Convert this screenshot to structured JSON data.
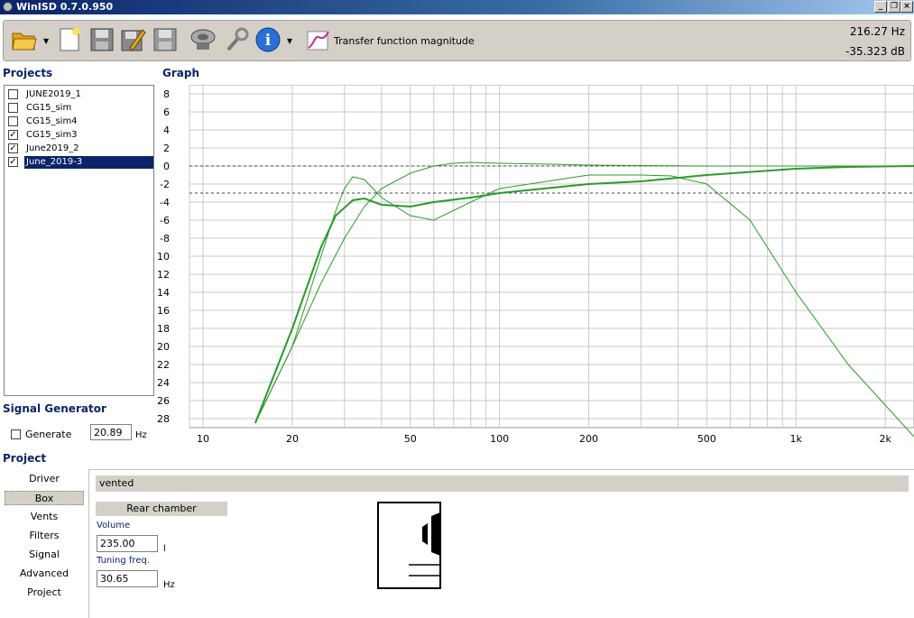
{
  "window": {
    "title": "WinISD 0.7.0.950"
  },
  "toolbar": {
    "graph_type_label": "Transfer function magnitude",
    "readout_hz": "216.27 Hz",
    "readout_db": "-35.323 dB"
  },
  "projects": {
    "heading": "Projects",
    "items": [
      {
        "label": "JUNE2019_1",
        "checked": false,
        "selected": false
      },
      {
        "label": "CG15_sim",
        "checked": false,
        "selected": false
      },
      {
        "label": "CG15_sim4",
        "checked": false,
        "selected": false
      },
      {
        "label": "CG15_sim3",
        "checked": true,
        "selected": false
      },
      {
        "label": "June2019_2",
        "checked": true,
        "selected": false
      },
      {
        "label": "June_2019-3",
        "checked": true,
        "selected": true
      }
    ]
  },
  "graph": {
    "heading": "Graph",
    "y_ticks": [
      "8",
      "6",
      "4",
      "2",
      "0",
      "-2",
      "-4",
      "-6",
      "-8",
      "-10",
      "-12",
      "-14",
      "-16",
      "-18",
      "-20",
      "-22",
      "-24",
      "-26",
      "-28"
    ],
    "x_ticks": [
      "10",
      "20",
      "50",
      "100",
      "200",
      "500",
      "1k",
      "2k"
    ]
  },
  "signal_generator": {
    "heading": "Signal Generator",
    "generate_label": "Generate",
    "checked": false,
    "frequency": "20.89",
    "unit": "Hz"
  },
  "project": {
    "heading": "Project",
    "nav": [
      "Driver",
      "Box",
      "Vents",
      "Filters",
      "Signal",
      "Advanced",
      "Project"
    ],
    "selected_nav": "Box",
    "box_type": "vented",
    "rear_chamber_label": "Rear chamber",
    "volume_label": "Volume",
    "volume_value": "235.00",
    "volume_unit": "l",
    "tuning_label": "Tuning freq.",
    "tuning_value": "30.65",
    "tuning_unit": "Hz"
  },
  "colors": {
    "curve": "#2a9a2a",
    "grid": "#c8c8c8",
    "heading": "#0a246a"
  },
  "chart_data": {
    "type": "line",
    "xlabel": "",
    "ylabel": "",
    "x_scale": "log",
    "xlim": [
      9,
      2500
    ],
    "ylim": [
      -29,
      9
    ],
    "reference_lines": [
      0,
      -3
    ],
    "series": [
      {
        "x": [
          15,
          20,
          25,
          28,
          30,
          32,
          35,
          40,
          50,
          60,
          80,
          100,
          200,
          300,
          380,
          500,
          700,
          1000,
          1500,
          2500
        ],
        "y": [
          -28.5,
          -20,
          -10,
          -5,
          -2.5,
          -1.2,
          -1.5,
          -3.5,
          -5.5,
          -6,
          -4,
          -2.5,
          -1,
          -1,
          -1.1,
          -2,
          -6,
          -14,
          -22,
          -30
        ]
      },
      {
        "x": [
          15,
          20,
          25,
          28,
          32,
          35,
          40,
          50,
          60,
          80,
          100,
          200,
          300,
          500,
          1000,
          1500,
          2500
        ],
        "y": [
          -28.5,
          -18,
          -9,
          -5.5,
          -3.8,
          -3.6,
          -4.3,
          -4.5,
          -4,
          -3.5,
          -3,
          -2,
          -1.7,
          -1,
          -0.3,
          -0.1,
          0
        ]
      },
      {
        "x": [
          15,
          20,
          25,
          30,
          35,
          40,
          50,
          60,
          70,
          80,
          100,
          150,
          200,
          300,
          500,
          1000,
          2500
        ],
        "y": [
          -28.5,
          -20,
          -13,
          -8,
          -4.5,
          -2.5,
          -0.8,
          0,
          0.3,
          0.4,
          0.3,
          0.2,
          0.1,
          0.05,
          0,
          0,
          0
        ]
      }
    ]
  }
}
